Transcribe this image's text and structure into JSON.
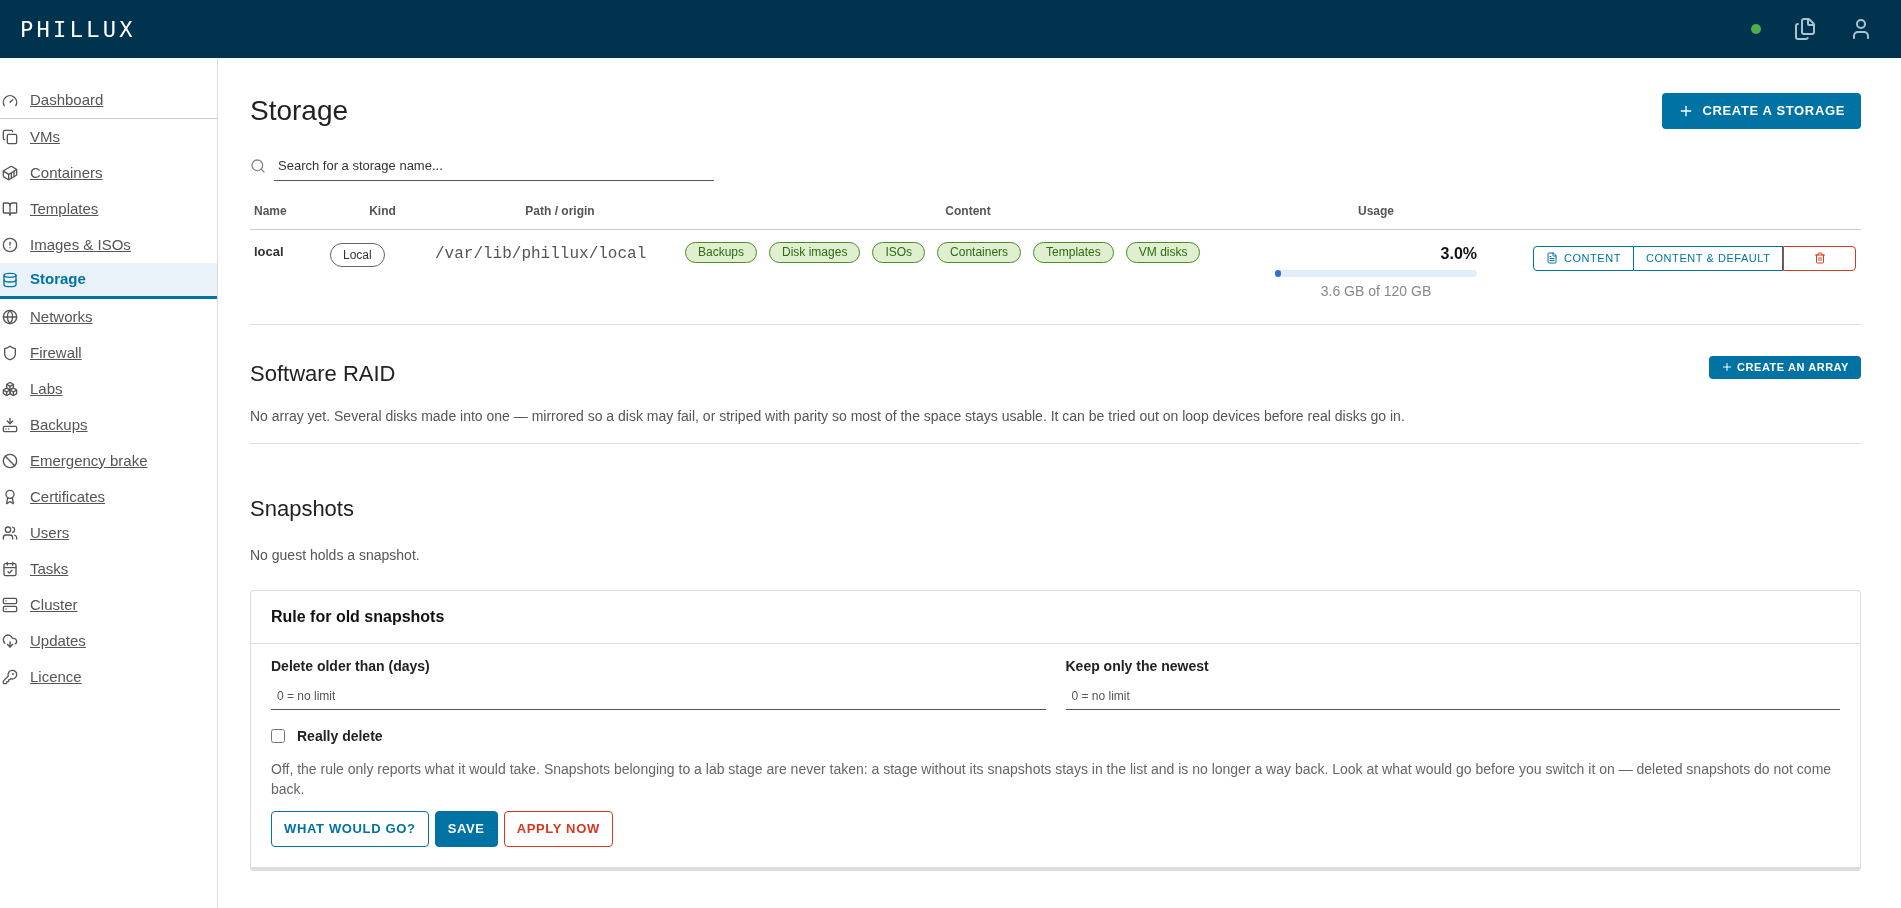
{
  "header": {
    "logo": "PHILLUX",
    "status": {
      "online": true
    }
  },
  "sidebar": {
    "items": [
      {
        "label": "Dashboard",
        "selected": false
      },
      {
        "label": "VMs",
        "selected": false
      },
      {
        "label": "Containers",
        "selected": false
      },
      {
        "label": "Templates",
        "selected": false
      },
      {
        "label": "Images & ISOs",
        "selected": false
      },
      {
        "label": "Storage",
        "selected": true
      },
      {
        "label": "Networks",
        "selected": false
      },
      {
        "label": "Firewall",
        "selected": false
      },
      {
        "label": "Labs",
        "selected": false
      },
      {
        "label": "Backups",
        "selected": false
      },
      {
        "label": "Emergency brake",
        "selected": false
      },
      {
        "label": "Certificates",
        "selected": false
      },
      {
        "label": "Users",
        "selected": false
      },
      {
        "label": "Tasks",
        "selected": false
      },
      {
        "label": "Cluster",
        "selected": false
      },
      {
        "label": "Updates",
        "selected": false
      },
      {
        "label": "Licence",
        "selected": false
      }
    ]
  },
  "storage": {
    "title": "Storage",
    "create_button": "CREATE A STORAGE",
    "search": {
      "placeholder": "Search for a storage name..."
    },
    "table": {
      "columns": [
        "Name",
        "Kind",
        "Path / origin",
        "Content",
        "Usage"
      ],
      "rows": [
        {
          "name": "local",
          "kind": "Local",
          "path": "/var/lib/phillux/local",
          "content": [
            "Backups",
            "Disk images",
            "ISOs",
            "Containers",
            "Templates",
            "VM disks"
          ],
          "percent": "3.0%",
          "level": 0.03,
          "usage": "3.6 GB of 120 GB",
          "actions": [
            "CONTENT",
            "CONTENT & DEFAULT"
          ]
        }
      ]
    }
  },
  "raid": {
    "title": "Software RAID",
    "create_button": "CREATE AN ARRAY",
    "text": "No array yet. Several disks made into one — mirrored so a disk may fail, or striped with parity so most of the space stays usable. It can be tried out on loop devices before real disks go in."
  },
  "snapshots": {
    "title": "Snapshots",
    "text": "No guest holds a snapshot.",
    "rule": {
      "title": "Rule for old snapshots",
      "fields": [
        {
          "label": "Delete older than (days)",
          "placeholder": "0 = no limit"
        },
        {
          "label": "Keep only the newest",
          "placeholder": "0 = no limit"
        }
      ],
      "checkbox": {
        "label": "Really delete",
        "checked": false
      },
      "note": "Off, the rule only reports what it would take. Snapshots belonging to a lab stage are never taken: a stage without its snapshots stays in the list and is no longer a way back. Look at what would go before you switch it on — deleted snapshots do not come back.",
      "buttons": [
        {
          "label": "WHAT WOULD GO?",
          "kind": "outline"
        },
        {
          "label": "SAVE",
          "kind": "primary"
        },
        {
          "label": "APPLY NOW",
          "kind": "danger"
        }
      ]
    }
  }
}
